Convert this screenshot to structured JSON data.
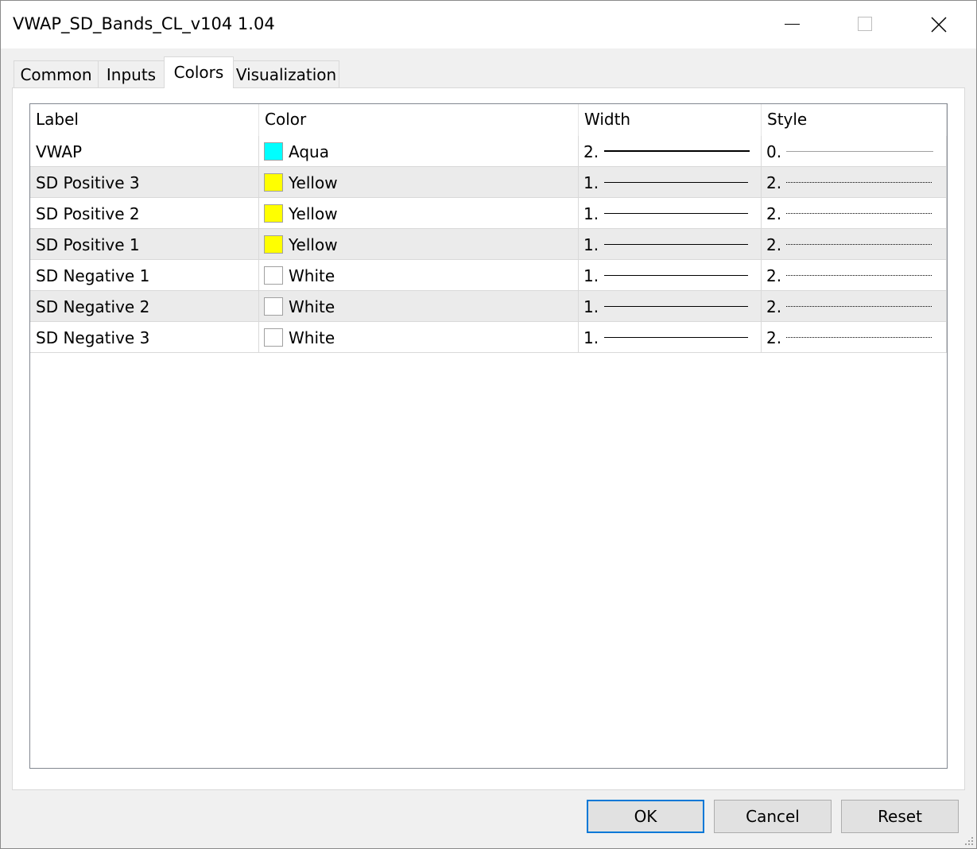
{
  "window": {
    "title": "VWAP_SD_Bands_CL_v104 1.04"
  },
  "tabs": [
    {
      "label": "Common",
      "active": false
    },
    {
      "label": "Inputs",
      "active": false
    },
    {
      "label": "Colors",
      "active": true
    },
    {
      "label": "Visualization",
      "active": false
    }
  ],
  "table": {
    "headers": {
      "label": "Label",
      "color": "Color",
      "width": "Width",
      "style": "Style"
    },
    "rows": [
      {
        "label": "VWAP",
        "color_name": "Aqua",
        "color_hex": "#00ffff",
        "width": "2.",
        "style": "0."
      },
      {
        "label": "SD Positive 3",
        "color_name": "Yellow",
        "color_hex": "#ffff00",
        "width": "1.",
        "style": "2."
      },
      {
        "label": "SD Positive 2",
        "color_name": "Yellow",
        "color_hex": "#ffff00",
        "width": "1.",
        "style": "2."
      },
      {
        "label": "SD Positive 1",
        "color_name": "Yellow",
        "color_hex": "#ffff00",
        "width": "1.",
        "style": "2."
      },
      {
        "label": "SD Negative 1",
        "color_name": "White",
        "color_hex": "#ffffff",
        "width": "1.",
        "style": "2."
      },
      {
        "label": "SD Negative 2",
        "color_name": "White",
        "color_hex": "#ffffff",
        "width": "1.",
        "style": "2."
      },
      {
        "label": "SD Negative 3",
        "color_name": "White",
        "color_hex": "#ffffff",
        "width": "1.",
        "style": "2."
      }
    ]
  },
  "buttons": {
    "ok": "OK",
    "cancel": "Cancel",
    "reset": "Reset"
  },
  "colors": {
    "accent": "#0078d7",
    "alt_row": "#ebebeb"
  }
}
